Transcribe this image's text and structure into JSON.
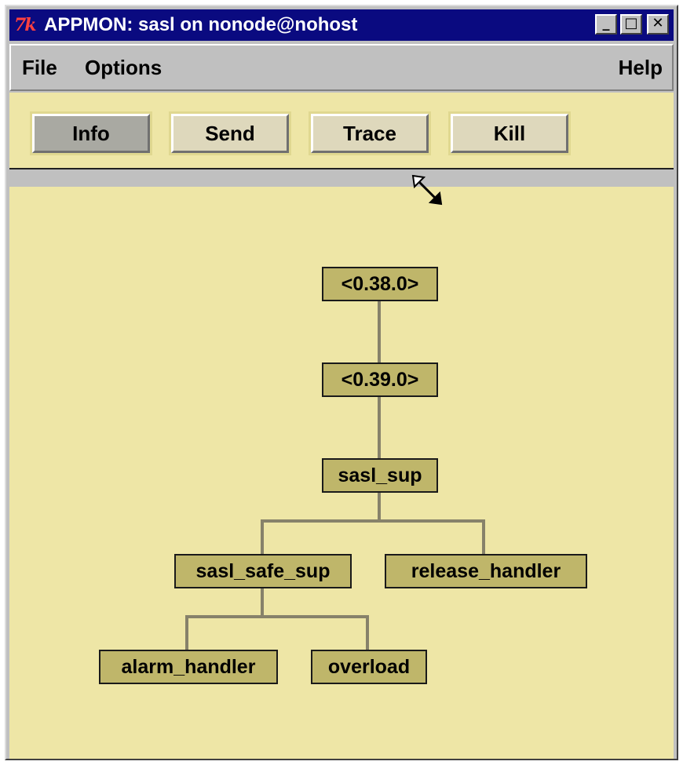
{
  "window": {
    "title": "APPMON: sasl on nonode@nohost",
    "logo": "7k",
    "controls": {
      "minimize_icon": "minimize-icon",
      "maximize_icon": "maximize-icon",
      "close_icon": "close-icon"
    }
  },
  "menubar": {
    "file": "File",
    "options": "Options",
    "help": "Help"
  },
  "toolbar": {
    "buttons": [
      {
        "label": "Info",
        "active": true
      },
      {
        "label": "Send",
        "active": false
      },
      {
        "label": "Trace",
        "active": false
      },
      {
        "label": "Kill",
        "active": false
      }
    ]
  },
  "tree": {
    "nodes": {
      "pid_38": "<0.38.0>",
      "pid_39": "<0.39.0>",
      "sasl_sup": "sasl_sup",
      "sasl_safe_sup": "sasl_safe_sup",
      "release_handler": "release_handler",
      "alarm_handler": "alarm_handler",
      "overload": "overload"
    }
  },
  "cursor": "resize-diagonal-icon",
  "colors": {
    "titlebar": "#0a0a80",
    "background": "#eee6a6",
    "node_fill": "#bfb66a",
    "connector": "#87826a",
    "chrome": "#c0c0c0"
  }
}
